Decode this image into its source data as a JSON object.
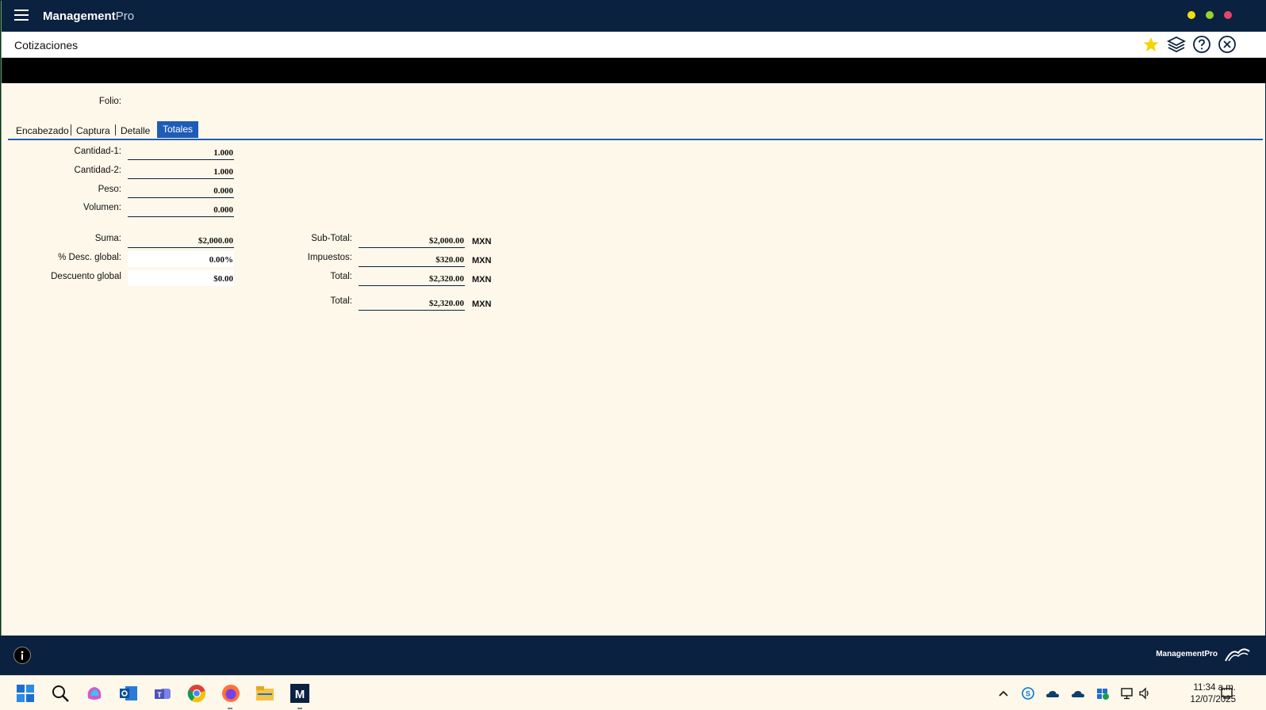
{
  "app": {
    "title_main": "Management",
    "title_suffix": "Pro",
    "colors": {
      "dot_yellow": "#f5e00a",
      "dot_green": "#9bd12a",
      "dot_red": "#e8446a",
      "accent": "#1f5cb8",
      "navy": "#0b2140"
    }
  },
  "header": {
    "title": "Cotizaciones",
    "icons": [
      "star-icon",
      "layers-icon",
      "help-icon",
      "close-icon"
    ]
  },
  "form": {
    "folio_label": "Folio:",
    "tabs": [
      {
        "label": "Encabezado"
      },
      {
        "label": "Captura"
      },
      {
        "label": "Detalle"
      },
      {
        "label": "Totales",
        "active": true
      }
    ],
    "left": {
      "cantidad1_label": "Cantidad-1:",
      "cantidad1_value": "1.000",
      "cantidad2_label": "Cantidad-2:",
      "cantidad2_value": "1.000",
      "peso_label": "Peso:",
      "peso_value": "0.000",
      "volumen_label": "Volumen:",
      "volumen_value": "0.000",
      "suma_label": "Suma:",
      "suma_value": "$2,000.00",
      "desc_pct_label": "% Desc. global:",
      "desc_pct_value": "0.00%",
      "descuento_label": "Descuento global",
      "descuento_value": "$0.00"
    },
    "right": {
      "subtotal_label": "Sub-Total:",
      "subtotal_value": "$2,000.00",
      "subtotal_currency": "MXN",
      "impuestos_label": "Impuestos:",
      "impuestos_value": "$320.00",
      "impuestos_currency": "MXN",
      "total_label": "Total:",
      "total_value": "$2,320.00",
      "total_currency": "MXN",
      "total2_label": "Total:",
      "total2_value": "$2,320.00",
      "total2_currency": "MXN"
    }
  },
  "footer": {
    "brand": "ManagementPro"
  },
  "taskbar": {
    "apps": [
      "windows-start-icon",
      "search-icon",
      "copilot-icon",
      "outlook-icon",
      "teams-icon",
      "chrome-icon",
      "firefox-icon",
      "file-explorer-icon",
      "managementpro-icon"
    ],
    "time": "11:34 a.m.",
    "date": "12/07/2025"
  }
}
